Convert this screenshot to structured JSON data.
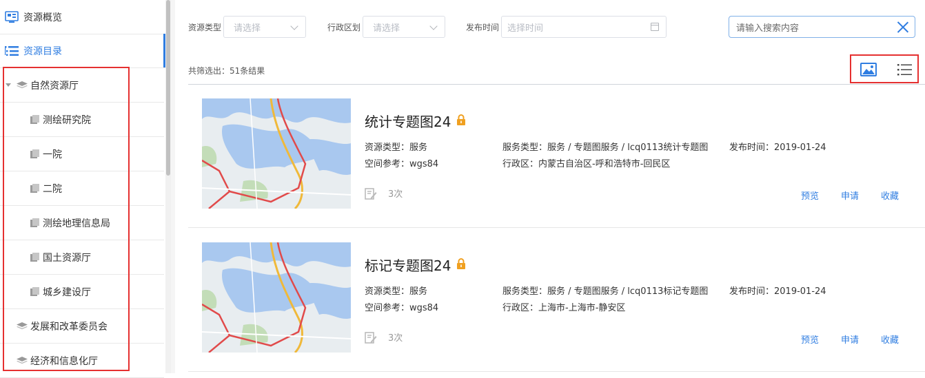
{
  "sidebar": {
    "overview_label": "资源概览",
    "catalog_label": "资源目录",
    "tree": [
      {
        "label": "自然资源厅",
        "type": "parent",
        "expanded": true
      },
      {
        "label": "测绘研究院",
        "type": "child"
      },
      {
        "label": "一院",
        "type": "child"
      },
      {
        "label": "二院",
        "type": "child"
      },
      {
        "label": "测绘地理信息局",
        "type": "child"
      },
      {
        "label": "国土资源厅",
        "type": "child"
      },
      {
        "label": "城乡建设厅",
        "type": "child"
      },
      {
        "label": "发展和改革委员会",
        "type": "parent"
      },
      {
        "label": "经济和信息化厅",
        "type": "parent"
      }
    ]
  },
  "filters": {
    "type_label": "资源类型",
    "type_placeholder": "请选择",
    "region_label": "行政区划",
    "region_placeholder": "请选择",
    "time_label": "发布时间",
    "time_placeholder": "选择时间"
  },
  "search": {
    "placeholder": "请输入搜索内容"
  },
  "results": {
    "summary": "共筛选出：51条结果",
    "items": [
      {
        "title": "统计专题图24",
        "resource_type": "资源类型：服务",
        "spatial_ref": "空间参考：wgs84",
        "service_type": "服务类型：服务 / 专题图服务 / lcq0113统计专题图",
        "region": "行政区：内蒙古自治区-呼和浩特市-回民区",
        "publish_time": "发布时间：2019-01-24",
        "usage_count": "3次",
        "actions": {
          "preview": "预览",
          "apply": "申请",
          "favorite": "收藏"
        }
      },
      {
        "title": "标记专题图24",
        "resource_type": "资源类型：服务",
        "spatial_ref": "空间参考：wgs84",
        "service_type": "服务类型：服务 / 专题图服务 / lcq0113标记专题图",
        "region": "行政区：上海市-上海市-静安区",
        "publish_time": "发布时间：2019-01-24",
        "usage_count": "3次",
        "actions": {
          "preview": "预览",
          "apply": "申请",
          "favorite": "收藏"
        }
      }
    ]
  },
  "colors": {
    "accent": "#2f7de1",
    "highlight": "#e53030",
    "lock": "#f0a020"
  }
}
